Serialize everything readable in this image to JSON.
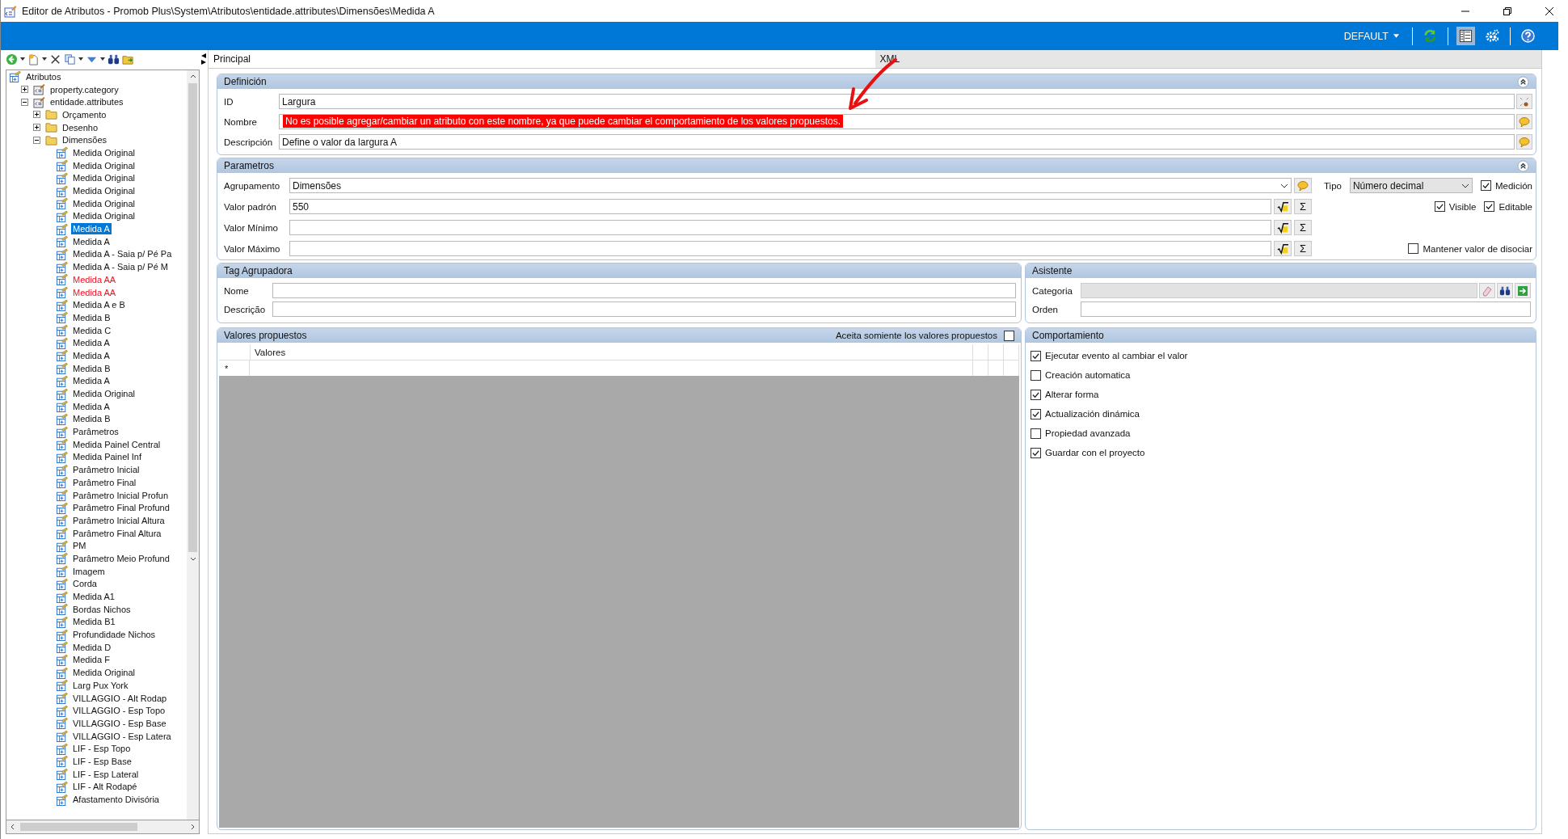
{
  "window": {
    "title": "Editor de Atributos - Promob Plus\\System\\Atributos\\entidade.attributes\\Dimensões\\Medida A"
  },
  "header_bar": {
    "profile": "DEFAULT",
    "tools": [
      {
        "kind": "refresh",
        "selected": false
      },
      {
        "kind": "layout",
        "selected": true
      },
      {
        "kind": "settings",
        "selected": false
      },
      {
        "kind": "help",
        "selected": false
      }
    ]
  },
  "tree": {
    "items": [
      {
        "kind": "root",
        "label": "Atributos",
        "selected": false,
        "children": [
          {
            "kind": "entity",
            "label": "property.category",
            "expanded": false,
            "selected": false
          },
          {
            "kind": "entity",
            "label": "entidade.attributes",
            "expanded": true,
            "selected": false,
            "children": [
              {
                "kind": "folder",
                "label": "Orçamento",
                "expanded": false,
                "selected": false
              },
              {
                "kind": "folder",
                "label": "Desenho",
                "expanded": false,
                "selected": false
              },
              {
                "kind": "folder",
                "label": "Dimensões",
                "expanded": true,
                "selected": false,
                "children": [
                  {
                    "kind": "attribute",
                    "label": "Medida Original",
                    "selected": false,
                    "flagged": false
                  },
                  {
                    "kind": "attribute",
                    "label": "Medida Original",
                    "selected": false,
                    "flagged": false
                  },
                  {
                    "kind": "attribute",
                    "label": "Medida Original",
                    "selected": false,
                    "flagged": false
                  },
                  {
                    "kind": "attribute",
                    "label": "Medida Original",
                    "selected": false,
                    "flagged": false
                  },
                  {
                    "kind": "attribute",
                    "label": "Medida Original",
                    "selected": false,
                    "flagged": false
                  },
                  {
                    "kind": "attribute",
                    "label": "Medida Original",
                    "selected": false,
                    "flagged": false
                  },
                  {
                    "kind": "attribute",
                    "label": "Medida A",
                    "selected": true,
                    "flagged": false
                  },
                  {
                    "kind": "attribute",
                    "label": "Medida A",
                    "selected": false,
                    "flagged": false
                  },
                  {
                    "kind": "attribute",
                    "label": "Medida A - Saia p/ Pé Pa",
                    "selected": false,
                    "flagged": false
                  },
                  {
                    "kind": "attribute",
                    "label": "Medida A - Saia p/ Pé M",
                    "selected": false,
                    "flagged": false
                  },
                  {
                    "kind": "attribute",
                    "label": "Medida AA",
                    "selected": false,
                    "flagged": true
                  },
                  {
                    "kind": "attribute",
                    "label": "Medida AA",
                    "selected": false,
                    "flagged": true
                  },
                  {
                    "kind": "attribute",
                    "label": "Medida A e B",
                    "selected": false,
                    "flagged": false
                  },
                  {
                    "kind": "attribute",
                    "label": "Medida B",
                    "selected": false,
                    "flagged": false
                  },
                  {
                    "kind": "attribute",
                    "label": "Medida C",
                    "selected": false,
                    "flagged": false
                  },
                  {
                    "kind": "attribute",
                    "label": "Medida A",
                    "selected": false,
                    "flagged": false
                  },
                  {
                    "kind": "attribute",
                    "label": "Medida A",
                    "selected": false,
                    "flagged": false
                  },
                  {
                    "kind": "attribute",
                    "label": "Medida B",
                    "selected": false,
                    "flagged": false
                  },
                  {
                    "kind": "attribute",
                    "label": "Medida A",
                    "selected": false,
                    "flagged": false
                  },
                  {
                    "kind": "attribute",
                    "label": "Medida Original",
                    "selected": false,
                    "flagged": false
                  },
                  {
                    "kind": "attribute",
                    "label": "Medida A",
                    "selected": false,
                    "flagged": false
                  },
                  {
                    "kind": "attribute",
                    "label": "Medida B",
                    "selected": false,
                    "flagged": false
                  },
                  {
                    "kind": "attribute",
                    "label": "Parâmetros",
                    "selected": false,
                    "flagged": false
                  },
                  {
                    "kind": "attribute",
                    "label": "Medida Painel Central",
                    "selected": false,
                    "flagged": false
                  },
                  {
                    "kind": "attribute",
                    "label": "Medida Painel Inf",
                    "selected": false,
                    "flagged": false
                  },
                  {
                    "kind": "attribute",
                    "label": "Parâmetro Inicial",
                    "selected": false,
                    "flagged": false
                  },
                  {
                    "kind": "attribute",
                    "label": "Parâmetro Final",
                    "selected": false,
                    "flagged": false
                  },
                  {
                    "kind": "attribute",
                    "label": "Parâmetro Inicial Profun",
                    "selected": false,
                    "flagged": false
                  },
                  {
                    "kind": "attribute",
                    "label": "Parâmetro Final Profund",
                    "selected": false,
                    "flagged": false
                  },
                  {
                    "kind": "attribute",
                    "label": "Parâmetro Inicial Altura",
                    "selected": false,
                    "flagged": false
                  },
                  {
                    "kind": "attribute",
                    "label": "Parâmetro Final Altura",
                    "selected": false,
                    "flagged": false
                  },
                  {
                    "kind": "attribute",
                    "label": "PM",
                    "selected": false,
                    "flagged": false
                  },
                  {
                    "kind": "attribute",
                    "label": "Parâmetro Meio Profund",
                    "selected": false,
                    "flagged": false
                  },
                  {
                    "kind": "attribute",
                    "label": "Imagem",
                    "selected": false,
                    "flagged": false
                  },
                  {
                    "kind": "attribute",
                    "label": "Corda",
                    "selected": false,
                    "flagged": false
                  },
                  {
                    "kind": "attribute",
                    "label": "Medida A1",
                    "selected": false,
                    "flagged": false
                  },
                  {
                    "kind": "attribute",
                    "label": "Bordas Nichos",
                    "selected": false,
                    "flagged": false
                  },
                  {
                    "kind": "attribute",
                    "label": "Medida B1",
                    "selected": false,
                    "flagged": false
                  },
                  {
                    "kind": "attribute",
                    "label": "Profundidade Nichos",
                    "selected": false,
                    "flagged": false
                  },
                  {
                    "kind": "attribute",
                    "label": "Medida D",
                    "selected": false,
                    "flagged": false
                  },
                  {
                    "kind": "attribute",
                    "label": "Medida F",
                    "selected": false,
                    "flagged": false
                  },
                  {
                    "kind": "attribute",
                    "label": "Medida Original",
                    "selected": false,
                    "flagged": false
                  },
                  {
                    "kind": "attribute",
                    "label": "Larg Pux York",
                    "selected": false,
                    "flagged": false
                  },
                  {
                    "kind": "attribute",
                    "label": "VILLAGGIO - Alt Rodap",
                    "selected": false,
                    "flagged": false
                  },
                  {
                    "kind": "attribute",
                    "label": "VILLAGGIO - Esp Topo",
                    "selected": false,
                    "flagged": false
                  },
                  {
                    "kind": "attribute",
                    "label": "VILLAGGIO - Esp Base",
                    "selected": false,
                    "flagged": false
                  },
                  {
                    "kind": "attribute",
                    "label": "VILLAGGIO - Esp Latera",
                    "selected": false,
                    "flagged": false
                  },
                  {
                    "kind": "attribute",
                    "label": "LIF - Esp Topo",
                    "selected": false,
                    "flagged": false
                  },
                  {
                    "kind": "attribute",
                    "label": "LIF - Esp Base",
                    "selected": false,
                    "flagged": false
                  },
                  {
                    "kind": "attribute",
                    "label": "LIF - Esp Lateral",
                    "selected": false,
                    "flagged": false
                  },
                  {
                    "kind": "attribute",
                    "label": "LIF - Alt Rodapé",
                    "selected": false,
                    "flagged": false
                  },
                  {
                    "kind": "attribute",
                    "label": "Afastamento Divisória",
                    "selected": false,
                    "flagged": false
                  }
                ]
              }
            ]
          }
        ]
      }
    ]
  },
  "tabs": [
    {
      "label": "Principal",
      "selected": true
    },
    {
      "label": "XML",
      "selected": false
    }
  ],
  "definicion": {
    "title": "Definición",
    "fields": [
      {
        "kind": "wizard",
        "label": "ID",
        "value": "Largura"
      },
      {
        "kind": "translate",
        "label": "Nombre"
      },
      {
        "kind": "translate",
        "label": "Descripción",
        "value": "Define o valor da largura A"
      }
    ],
    "error": "No es posible agregar/cambiar un atributo con este nombre, ya que puede cambiar el comportamiento de los valores propuestos."
  },
  "parametros": {
    "title": "Parametros",
    "agrupamento": {
      "label": "Agrupamento",
      "value": "Dimensões"
    },
    "tipo": {
      "label": "Tipo",
      "value": "Número decimal"
    },
    "values": [
      {
        "label": "Valor padrón",
        "value": "550",
        "sum": "Σ"
      },
      {
        "label": "Valor Mínimo",
        "sum": "Σ"
      },
      {
        "label": "Valor Máximo",
        "sum": "Σ"
      }
    ],
    "options": [
      {
        "label": "Medición",
        "checked": true
      },
      {
        "label": "Visible",
        "checked": true
      },
      {
        "label": "Editable",
        "checked": true
      },
      {
        "label": "Mantener valor de disociar",
        "checked": false
      }
    ]
  },
  "tag_agrupadora": {
    "title": "Tag Agrupadora",
    "fields": [
      {
        "label": "Nome"
      },
      {
        "label": "Descrição"
      }
    ]
  },
  "asistente": {
    "title": "Asistente",
    "fields": [
      {
        "label": "Categoria",
        "disabled": true
      },
      {
        "label": "Orden",
        "disabled": false
      }
    ]
  },
  "valores_propuestos": {
    "title": "Valores propuestos",
    "accept_only": {
      "label": "Aceita somiente los valores propuestos",
      "checked": false
    },
    "columns": [
      "Valores"
    ],
    "new_row_marker": "*"
  },
  "comportamiento": {
    "title": "Comportamiento",
    "options": [
      {
        "label": "Ejecutar evento al cambiar el valor",
        "checked": true
      },
      {
        "label": "Creación automatica",
        "checked": false
      },
      {
        "label": "Alterar forma",
        "checked": true
      },
      {
        "label": "Actualización dinámica",
        "checked": true
      },
      {
        "label": "Propiedad avanzada",
        "checked": false
      },
      {
        "label": "Guardar con el proyecto",
        "checked": true
      }
    ]
  }
}
